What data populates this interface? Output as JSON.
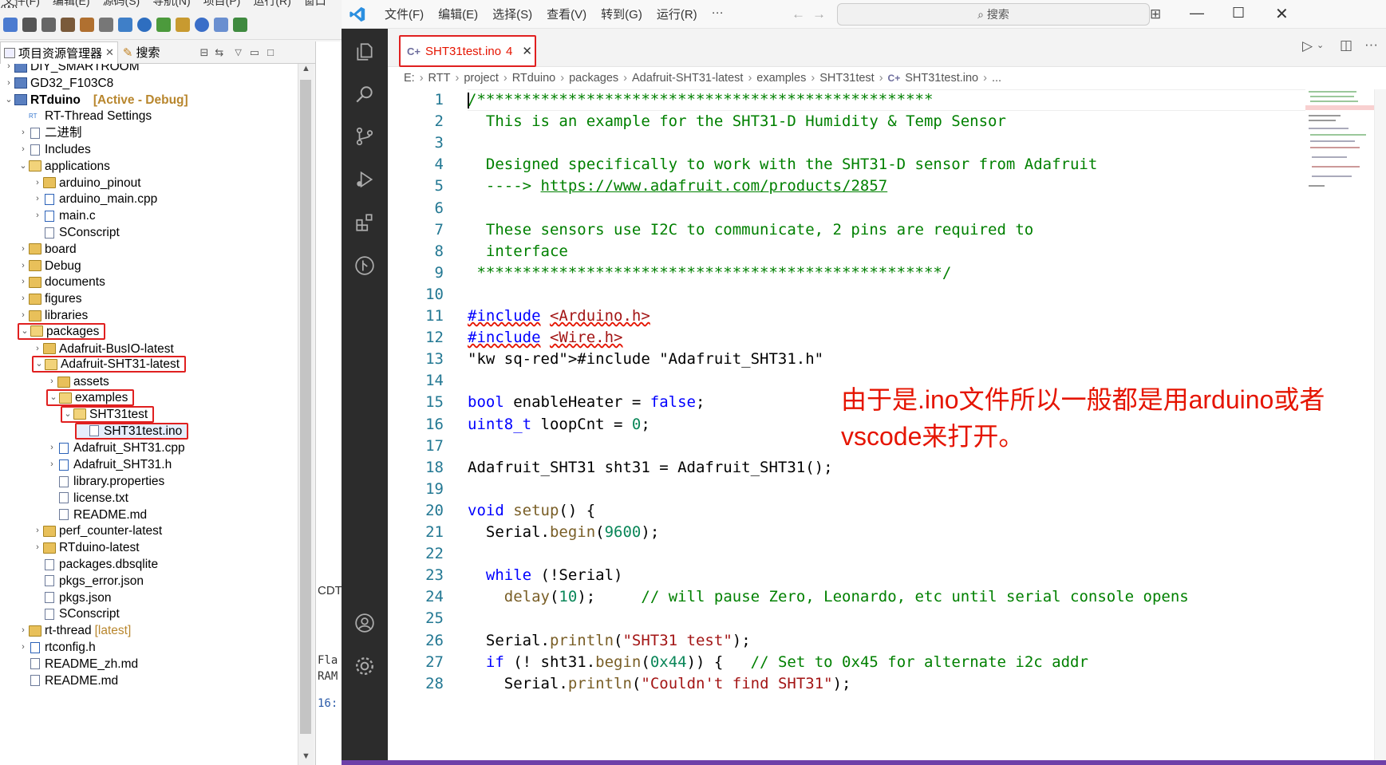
{
  "eclipse": {
    "menubar": [
      "文件(F)",
      "编辑(E)",
      "源码(S)",
      "导航(N)",
      "项目(P)",
      "运行(R)",
      "窗口(W)"
    ],
    "tabs": {
      "project_explorer": "项目资源管理器",
      "search": "搜索"
    },
    "tree": [
      {
        "label": "DIY_SMARTROOM",
        "depth": 0,
        "expanded": false,
        "icon": "project-icon"
      },
      {
        "label": "GD32_F103C8",
        "depth": 0,
        "expanded": false,
        "icon": "project-icon"
      },
      {
        "label": "RTduino",
        "suffix": "[Active - Debug]",
        "depth": 0,
        "expanded": true,
        "icon": "project-icon"
      },
      {
        "label": "RT-Thread Settings",
        "depth": 1,
        "icon": "rt-thread-settings-icon"
      },
      {
        "label": "二进制",
        "depth": 1,
        "expanded": false,
        "icon": "binaries-icon"
      },
      {
        "label": "Includes",
        "depth": 1,
        "expanded": false,
        "icon": "includes-icon"
      },
      {
        "label": "applications",
        "depth": 1,
        "expanded": true,
        "icon": "folder-icon"
      },
      {
        "label": "arduino_pinout",
        "depth": 2,
        "expanded": false,
        "icon": "folder-icon"
      },
      {
        "label": "arduino_main.cpp",
        "depth": 2,
        "expanded": false,
        "icon": "cpp-file-icon"
      },
      {
        "label": "main.c",
        "depth": 2,
        "expanded": false,
        "icon": "c-file-icon"
      },
      {
        "label": "SConscript",
        "depth": 2,
        "icon": "file-icon"
      },
      {
        "label": "board",
        "depth": 1,
        "expanded": false,
        "icon": "folder-icon"
      },
      {
        "label": "Debug",
        "depth": 1,
        "expanded": false,
        "icon": "folder-icon"
      },
      {
        "label": "documents",
        "depth": 1,
        "expanded": false,
        "icon": "folder-icon"
      },
      {
        "label": "figures",
        "depth": 1,
        "expanded": false,
        "icon": "folder-icon"
      },
      {
        "label": "libraries",
        "depth": 1,
        "expanded": false,
        "icon": "folder-icon"
      },
      {
        "label": "packages",
        "depth": 1,
        "expanded": true,
        "icon": "folder-icon",
        "highlight": true
      },
      {
        "label": "Adafruit-BusIO-latest",
        "depth": 2,
        "expanded": false,
        "icon": "folder-icon"
      },
      {
        "label": "Adafruit-SHT31-latest",
        "depth": 2,
        "expanded": true,
        "icon": "folder-icon",
        "highlight": true
      },
      {
        "label": "assets",
        "depth": 3,
        "expanded": false,
        "icon": "folder-icon"
      },
      {
        "label": "examples",
        "depth": 3,
        "expanded": true,
        "icon": "folder-icon",
        "highlight": true
      },
      {
        "label": "SHT31test",
        "depth": 4,
        "expanded": true,
        "icon": "folder-icon",
        "highlight": true
      },
      {
        "label": "SHT31test.ino",
        "depth": 5,
        "icon": "file-icon",
        "highlight": true,
        "selected": true
      },
      {
        "label": "Adafruit_SHT31.cpp",
        "depth": 3,
        "expanded": false,
        "icon": "cpp-file-icon"
      },
      {
        "label": "Adafruit_SHT31.h",
        "depth": 3,
        "expanded": false,
        "icon": "header-file-icon"
      },
      {
        "label": "library.properties",
        "depth": 3,
        "icon": "file-icon"
      },
      {
        "label": "license.txt",
        "depth": 3,
        "icon": "file-icon"
      },
      {
        "label": "README.md",
        "depth": 3,
        "icon": "file-icon"
      },
      {
        "label": "perf_counter-latest",
        "depth": 2,
        "expanded": false,
        "icon": "folder-icon"
      },
      {
        "label": "RTduino-latest",
        "depth": 2,
        "expanded": false,
        "icon": "folder-icon"
      },
      {
        "label": "packages.dbsqlite",
        "depth": 2,
        "icon": "file-icon"
      },
      {
        "label": "pkgs_error.json",
        "depth": 2,
        "icon": "file-icon"
      },
      {
        "label": "pkgs.json",
        "depth": 2,
        "icon": "file-icon"
      },
      {
        "label": "SConscript",
        "depth": 2,
        "icon": "file-icon"
      },
      {
        "label": "rt-thread",
        "suffix": "[latest]",
        "depth": 1,
        "expanded": false,
        "icon": "folder-icon"
      },
      {
        "label": "rtconfig.h",
        "depth": 1,
        "expanded": false,
        "icon": "header-file-icon"
      },
      {
        "label": "README_zh.md",
        "depth": 1,
        "icon": "file-icon"
      },
      {
        "label": "README.md",
        "depth": 1,
        "icon": "file-icon"
      }
    ],
    "mid_fragments": {
      "cdt": "CDT",
      "fla": "Fla",
      "ram": "RAM",
      "sixteen": "16:"
    }
  },
  "vscode": {
    "menu": [
      "文件(F)",
      "编辑(E)",
      "选择(S)",
      "查看(V)",
      "转到(G)",
      "运行(R)",
      "···"
    ],
    "search_placeholder": "搜索",
    "tab": {
      "name": "SHT31test.ino",
      "badge": "4"
    },
    "breadcrumb": [
      "E:",
      "RTT",
      "project",
      "RTduino",
      "packages",
      "Adafruit-SHT31-latest",
      "examples",
      "SHT31test",
      "SHT31test.ino",
      "..."
    ],
    "code_lines": [
      "/**************************************************",
      "  This is an example for the SHT31-D Humidity & Temp Sensor",
      "",
      "  Designed specifically to work with the SHT31-D sensor from Adafruit",
      "  ----> https://www.adafruit.com/products/2857",
      "",
      "  These sensors use I2C to communicate, 2 pins are required to",
      "  interface",
      " ***************************************************/",
      "",
      "#include <Arduino.h>",
      "#include <Wire.h>",
      "#include \"Adafruit_SHT31.h\"",
      "",
      "bool enableHeater = false;",
      "uint8_t loopCnt = 0;",
      "",
      "Adafruit_SHT31 sht31 = Adafruit_SHT31();",
      "",
      "void setup() {",
      "  Serial.begin(9600);",
      "",
      "  while (!Serial)",
      "    delay(10);     // will pause Zero, Leonardo, etc until serial console opens",
      "",
      "  Serial.println(\"SHT31 test\");",
      "  if (! sht31.begin(0x44)) {   // Set to 0x45 for alternate i2c addr",
      "    Serial.println(\"Couldn't find SHT31\");"
    ],
    "annotation": "由于是.ino文件所以一般都是用arduino或者vscode来打开。",
    "colors": {
      "accent": "#e51400",
      "activity_bar": "#2c2c2c",
      "line_number": "#237893"
    }
  }
}
